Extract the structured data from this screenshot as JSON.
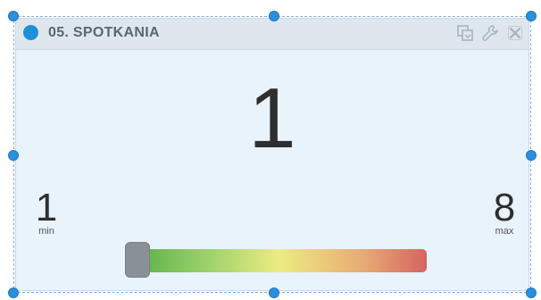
{
  "widget": {
    "title": "05. SPOTKANIA",
    "value": "1",
    "min_value": "1",
    "min_label": "min",
    "max_value": "8",
    "max_label": "max",
    "slider_value": 1,
    "header_icons": [
      "refresh-icon",
      "wrench-icon",
      "close-icon"
    ]
  },
  "colors": {
    "status_dot": "#1e90d8",
    "header_bg": "#dfe7ee",
    "body_bg": "#e8f3fb",
    "gradient": [
      "#57b046",
      "#ecec82",
      "#d66461"
    ],
    "handle": "#8a9196",
    "selection_handle": "#2b8fdc"
  }
}
